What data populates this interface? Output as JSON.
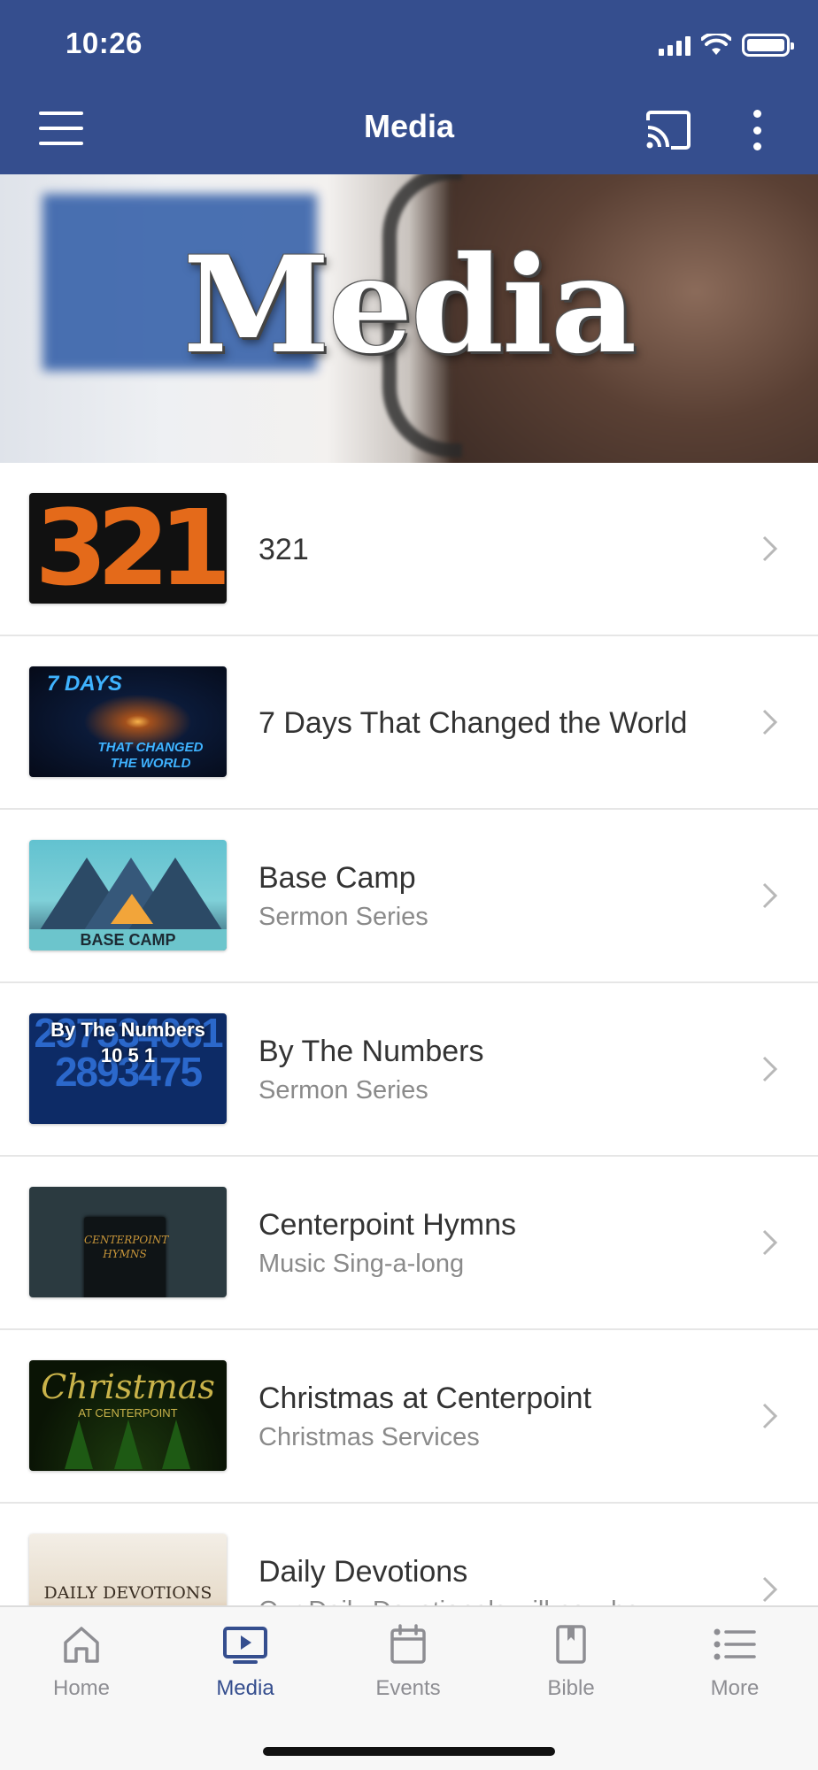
{
  "status_bar": {
    "time": "10:26"
  },
  "app_bar": {
    "title": "Media"
  },
  "banner": {
    "title": "Media"
  },
  "list": {
    "items": [
      {
        "title": "321",
        "subtitle": "",
        "thumbnail_text": "321"
      },
      {
        "title": "7 Days That Changed the World",
        "subtitle": "",
        "thumbnail_text": "7 DAYS",
        "thumbnail_text_2": "THAT CHANGED THE WORLD"
      },
      {
        "title": "Base Camp",
        "subtitle": "Sermon Series",
        "thumbnail_text": "BASE CAMP"
      },
      {
        "title": "By The Numbers",
        "subtitle": "Sermon Series",
        "thumbnail_text": "By The Numbers",
        "thumbnail_text_2": "10 5 1"
      },
      {
        "title": "Centerpoint Hymns",
        "subtitle": "Music Sing-a-long",
        "thumbnail_text": "CENTERPOINT HYMNS"
      },
      {
        "title": "Christmas at Centerpoint",
        "subtitle": "Christmas Services",
        "thumbnail_text": "Christmas",
        "thumbnail_text_2": "AT CENTERPOINT"
      },
      {
        "title": "Daily Devotions",
        "subtitle": "Our Daily Devotionals will now be",
        "thumbnail_text": "DAILY DEVOTIONS"
      }
    ]
  },
  "tabbar": {
    "items": [
      {
        "label": "Home",
        "icon": "home-icon",
        "active": false
      },
      {
        "label": "Media",
        "icon": "media-icon",
        "active": true
      },
      {
        "label": "Events",
        "icon": "calendar-icon",
        "active": false
      },
      {
        "label": "Bible",
        "icon": "bible-icon",
        "active": false
      },
      {
        "label": "More",
        "icon": "list-icon",
        "active": false
      }
    ]
  },
  "colors": {
    "brand": "#354e8e",
    "inactive_tab": "#8e8e93",
    "subtitle": "#8a8a8a"
  }
}
